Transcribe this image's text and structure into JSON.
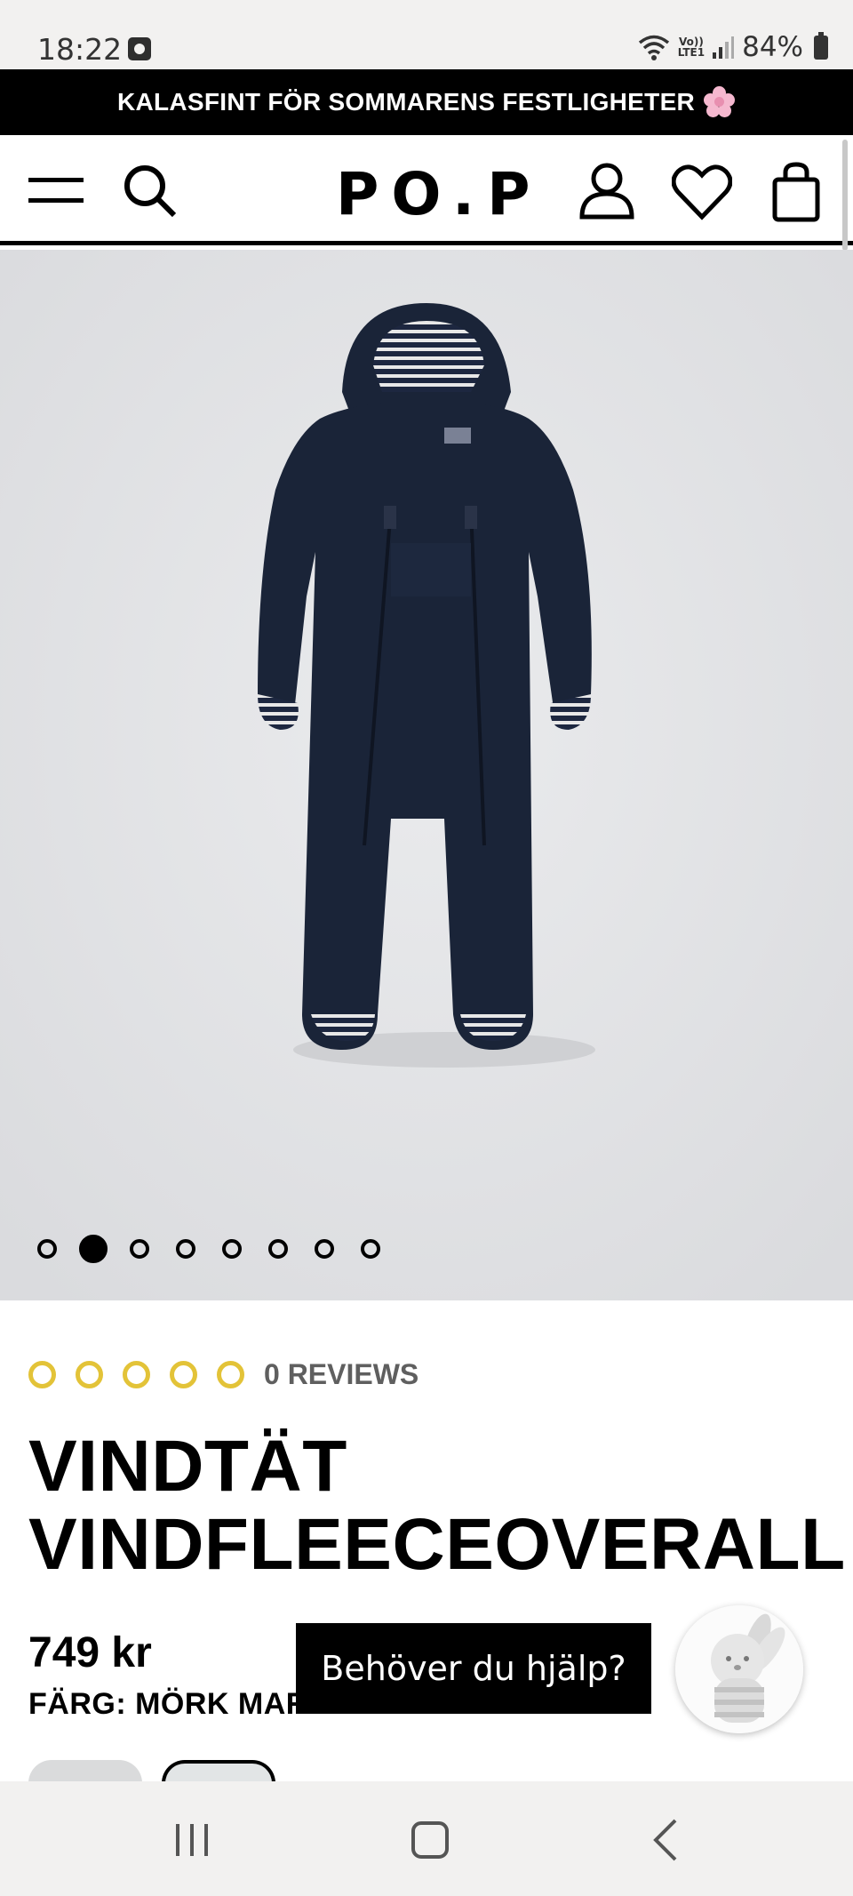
{
  "status_bar": {
    "time": "18:22",
    "network_label": "Vo))\nLTE1",
    "battery": "84%"
  },
  "promo": {
    "text": "KALASFINT FÖR SOMMARENS FESTLIGHETER",
    "icon": "flower-icon"
  },
  "header": {
    "logo": "PO.P",
    "icons": [
      "menu-icon",
      "search-icon",
      "account-icon",
      "heart-icon",
      "bag-icon"
    ]
  },
  "gallery": {
    "image_description_icon": "product-photo",
    "dot_count": 8,
    "active_dot": 1
  },
  "product": {
    "rating_value": 0,
    "rating_max": 5,
    "reviews": "0 REVIEWS",
    "title": "VINDTÄT VINDFLEECEOVERALL",
    "price": "749 kr",
    "color": "FÄRG: MÖRK MARINBLÅ"
  },
  "help": {
    "label": "Behöver du hjälp?"
  },
  "colors": {
    "promo_bg": "#000000",
    "image_bg": "#e2e3e5",
    "star_color": "#e3c338",
    "garment": "#1a2438"
  },
  "nav": {
    "icons": [
      "recent-apps-icon",
      "home-icon",
      "back-icon"
    ]
  }
}
